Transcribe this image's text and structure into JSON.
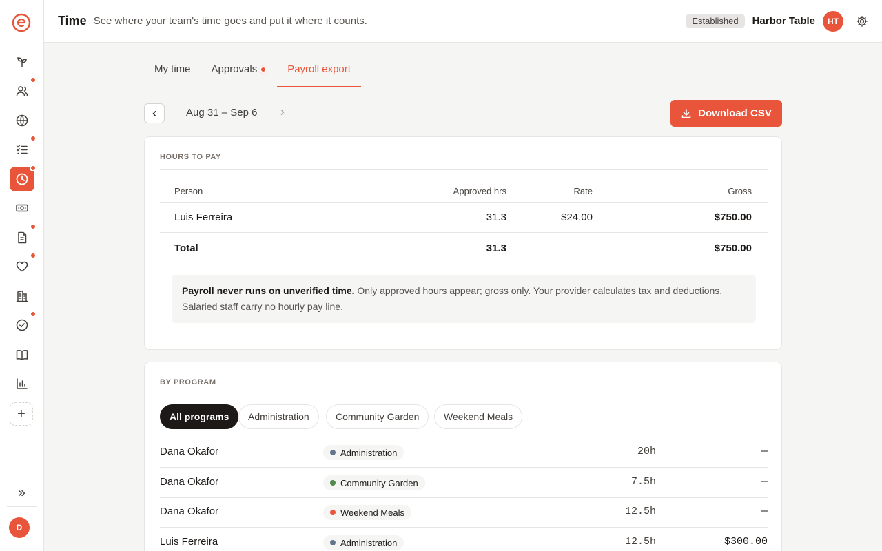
{
  "header": {
    "title": "Time",
    "subtitle": "See where your team's time goes and put it where it counts.",
    "status_badge": "Established",
    "org_name": "Harbor Table",
    "org_initials": "HT"
  },
  "sidebar": {
    "user_initial": "D",
    "items": [
      {
        "icon": "sprout-icon",
        "badge": false,
        "active": false
      },
      {
        "icon": "people-icon",
        "badge": true,
        "active": false
      },
      {
        "icon": "globe-icon",
        "badge": false,
        "active": false
      },
      {
        "icon": "checklist-icon",
        "badge": true,
        "active": false
      },
      {
        "icon": "clock-icon",
        "badge": true,
        "active": true
      },
      {
        "icon": "cash-icon",
        "badge": false,
        "active": false
      },
      {
        "icon": "document-icon",
        "badge": true,
        "active": false
      },
      {
        "icon": "heart-icon",
        "badge": true,
        "active": false
      },
      {
        "icon": "building-icon",
        "badge": false,
        "active": false
      },
      {
        "icon": "check-circle-icon",
        "badge": true,
        "active": false
      },
      {
        "icon": "book-icon",
        "badge": false,
        "active": false
      },
      {
        "icon": "bar-chart-icon",
        "badge": false,
        "active": false
      }
    ]
  },
  "tabs": [
    {
      "label": "My time",
      "active": false,
      "dot": false
    },
    {
      "label": "Approvals",
      "active": false,
      "dot": true
    },
    {
      "label": "Payroll export",
      "active": true,
      "dot": false
    }
  ],
  "week": {
    "range": "Aug 31 – Sep 6"
  },
  "download_label": "Download CSV",
  "hours_card": {
    "label": "HOURS TO PAY",
    "columns": {
      "person": "Person",
      "approved": "Approved hrs",
      "rate": "Rate",
      "gross": "Gross"
    },
    "rows": [
      {
        "person": "Luis Ferreira",
        "approved": "31.3",
        "rate": "$24.00",
        "gross": "$750.00"
      }
    ],
    "total": {
      "label": "Total",
      "approved": "31.3",
      "gross": "$750.00"
    },
    "note_bold": "Payroll never runs on unverified time.",
    "note_text": " Only approved hours appear; gross only. Your provider calculates tax and deductions. Salaried staff carry no hourly pay line."
  },
  "program_card": {
    "label": "BY PROGRAM",
    "filters": [
      "All programs",
      "Administration",
      "Community Garden",
      "Weekend Meals"
    ],
    "active_filter": 0,
    "program_colors": {
      "Administration": "#64748b",
      "Community Garden": "#4f8a4b",
      "Weekend Meals": "#e8553a"
    },
    "rows": [
      {
        "person": "Dana Okafor",
        "program": "Administration",
        "hours": "20h",
        "amount": "—"
      },
      {
        "person": "Dana Okafor",
        "program": "Community Garden",
        "hours": "7.5h",
        "amount": "—"
      },
      {
        "person": "Dana Okafor",
        "program": "Weekend Meals",
        "hours": "12.5h",
        "amount": "—"
      },
      {
        "person": "Luis Ferreira",
        "program": "Administration",
        "hours": "12.5h",
        "amount": "$300.00"
      }
    ]
  },
  "colors": {
    "accent": "#e8553a",
    "dark": "#1c1917"
  }
}
